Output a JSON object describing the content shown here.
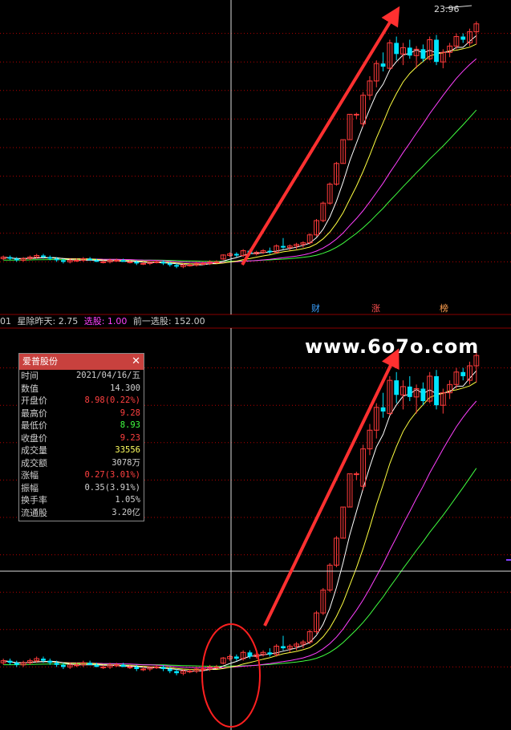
{
  "colors": {
    "up": "#ff3b3b",
    "down": "#00e5ff",
    "ma5": "#ffffff",
    "ma10": "#ffff40",
    "ma20": "#ff40ff",
    "ma60": "#40ff40",
    "grid": "#b40000",
    "arrow": "#ff3030"
  },
  "top_panel": {
    "peak_label": "23.96",
    "markers": [
      {
        "text": "财",
        "color": "#3aa0ff"
      },
      {
        "text": "涨",
        "color": "#ff5050"
      },
      {
        "text": "榜",
        "color": "#ffa050"
      }
    ]
  },
  "indicator_bar": {
    "prefix": "01",
    "name": "星除昨天: 2.75",
    "xg_label": "选股: 1.00",
    "prev_label": "前一选股: 152.00"
  },
  "watermark": "www.6o7o.com",
  "infobox": {
    "title": "爱普股份",
    "rows": [
      {
        "label": "时间",
        "value": "2021/04/16/五",
        "color": "#d0d0d0"
      },
      {
        "label": "数值",
        "value": "14.300",
        "color": "#d0d0d0"
      },
      {
        "label": "开盘价",
        "value": "8.98(0.22%)",
        "color": "#ff4040"
      },
      {
        "label": "最高价",
        "value": "9.28",
        "color": "#ff4040"
      },
      {
        "label": "最低价",
        "value": "8.93",
        "color": "#40ff40"
      },
      {
        "label": "收盘价",
        "value": "9.23",
        "color": "#ff4040"
      },
      {
        "label": "成交量",
        "value": "33556",
        "color": "#ffff60"
      },
      {
        "label": "成交额",
        "value": "3078万",
        "color": "#d0d0d0"
      },
      {
        "label": "涨幅",
        "value": "0.27(3.01%)",
        "color": "#ff4040"
      },
      {
        "label": "振幅",
        "value": "0.35(3.91%)",
        "color": "#d0d0d0"
      },
      {
        "label": "换手率",
        "value": "1.05%",
        "color": "#d0d0d0"
      },
      {
        "label": "流通股",
        "value": "3.20亿",
        "color": "#d0d0d0"
      }
    ]
  },
  "chart_data": {
    "type": "candlestick",
    "ylim": [
      7,
      25
    ],
    "peak": 23.96,
    "candles": [
      [
        9.0,
        9.2,
        8.9,
        9.1
      ],
      [
        9.1,
        9.2,
        8.9,
        9.0
      ],
      [
        9.0,
        9.1,
        8.8,
        8.9
      ],
      [
        8.9,
        9.1,
        8.8,
        9.0
      ],
      [
        9.0,
        9.2,
        8.9,
        9.1
      ],
      [
        9.1,
        9.3,
        9.0,
        9.2
      ],
      [
        9.2,
        9.3,
        9.0,
        9.1
      ],
      [
        9.1,
        9.2,
        8.9,
        9.0
      ],
      [
        9.0,
        9.1,
        8.8,
        8.9
      ],
      [
        8.9,
        9.0,
        8.7,
        8.8
      ],
      [
        8.8,
        9.0,
        8.7,
        8.9
      ],
      [
        8.9,
        9.0,
        8.8,
        8.9
      ],
      [
        8.9,
        9.1,
        8.8,
        9.0
      ],
      [
        9.0,
        9.1,
        8.9,
        8.9
      ],
      [
        8.9,
        9.0,
        8.8,
        8.8
      ],
      [
        8.8,
        8.9,
        8.7,
        8.8
      ],
      [
        8.8,
        9.0,
        8.7,
        8.9
      ],
      [
        8.9,
        9.0,
        8.8,
        8.9
      ],
      [
        8.9,
        9.0,
        8.8,
        8.8
      ],
      [
        8.8,
        8.9,
        8.7,
        8.8
      ],
      [
        8.8,
        8.9,
        8.6,
        8.7
      ],
      [
        8.7,
        8.8,
        8.6,
        8.7
      ],
      [
        8.7,
        8.8,
        8.6,
        8.8
      ],
      [
        8.8,
        8.9,
        8.7,
        8.8
      ],
      [
        8.8,
        8.9,
        8.6,
        8.7
      ],
      [
        8.7,
        8.8,
        8.5,
        8.6
      ],
      [
        8.6,
        8.7,
        8.4,
        8.5
      ],
      [
        8.5,
        8.7,
        8.4,
        8.6
      ],
      [
        8.6,
        8.7,
        8.5,
        8.6
      ],
      [
        8.6,
        8.8,
        8.5,
        8.7
      ],
      [
        8.7,
        8.8,
        8.6,
        8.7
      ],
      [
        8.7,
        8.9,
        8.6,
        8.8
      ],
      [
        8.8,
        8.9,
        8.7,
        8.8
      ],
      [
        8.98,
        9.28,
        8.93,
        9.23
      ],
      [
        9.2,
        9.4,
        9.1,
        9.3
      ],
      [
        9.3,
        9.4,
        9.1,
        9.2
      ],
      [
        9.2,
        9.6,
        9.1,
        9.5
      ],
      [
        9.5,
        9.6,
        9.2,
        9.3
      ],
      [
        9.3,
        9.5,
        9.2,
        9.4
      ],
      [
        9.4,
        9.6,
        9.3,
        9.5
      ],
      [
        9.5,
        9.7,
        9.3,
        9.4
      ],
      [
        9.4,
        9.9,
        9.3,
        9.8
      ],
      [
        9.8,
        10.3,
        9.6,
        9.7
      ],
      [
        9.7,
        9.9,
        9.5,
        9.8
      ],
      [
        9.8,
        10.0,
        9.6,
        9.9
      ],
      [
        9.9,
        10.1,
        9.7,
        10.0
      ],
      [
        10.0,
        10.6,
        9.9,
        10.5
      ],
      [
        10.5,
        11.5,
        10.4,
        11.4
      ],
      [
        11.4,
        12.6,
        11.3,
        12.5
      ],
      [
        12.5,
        13.8,
        12.4,
        13.7
      ],
      [
        13.7,
        15.1,
        13.6,
        15.0
      ],
      [
        15.0,
        16.5,
        15.0,
        16.5
      ],
      [
        16.5,
        18.1,
        16.5,
        18.1
      ],
      [
        18.1,
        18.2,
        17.8,
        18.1
      ],
      [
        17.5,
        19.5,
        17.3,
        19.3
      ],
      [
        19.3,
        20.5,
        19.0,
        20.2
      ],
      [
        20.2,
        21.5,
        19.8,
        21.3
      ],
      [
        21.3,
        22.0,
        20.8,
        21.1
      ],
      [
        21.0,
        22.8,
        20.9,
        22.6
      ],
      [
        22.6,
        23.0,
        21.5,
        21.9
      ],
      [
        21.9,
        22.6,
        21.2,
        22.3
      ],
      [
        22.3,
        22.8,
        21.6,
        21.8
      ],
      [
        21.8,
        22.4,
        21.0,
        22.2
      ],
      [
        22.2,
        22.5,
        21.4,
        21.6
      ],
      [
        21.6,
        23.0,
        21.5,
        22.8
      ],
      [
        22.8,
        23.1,
        21.2,
        21.4
      ],
      [
        21.4,
        22.2,
        21.0,
        22.0
      ],
      [
        22.0,
        22.6,
        21.7,
        22.4
      ],
      [
        22.4,
        23.2,
        22.2,
        23.0
      ],
      [
        23.0,
        23.2,
        22.6,
        22.8
      ],
      [
        22.6,
        23.5,
        22.4,
        23.3
      ],
      [
        23.3,
        23.96,
        22.5,
        23.8
      ]
    ]
  }
}
